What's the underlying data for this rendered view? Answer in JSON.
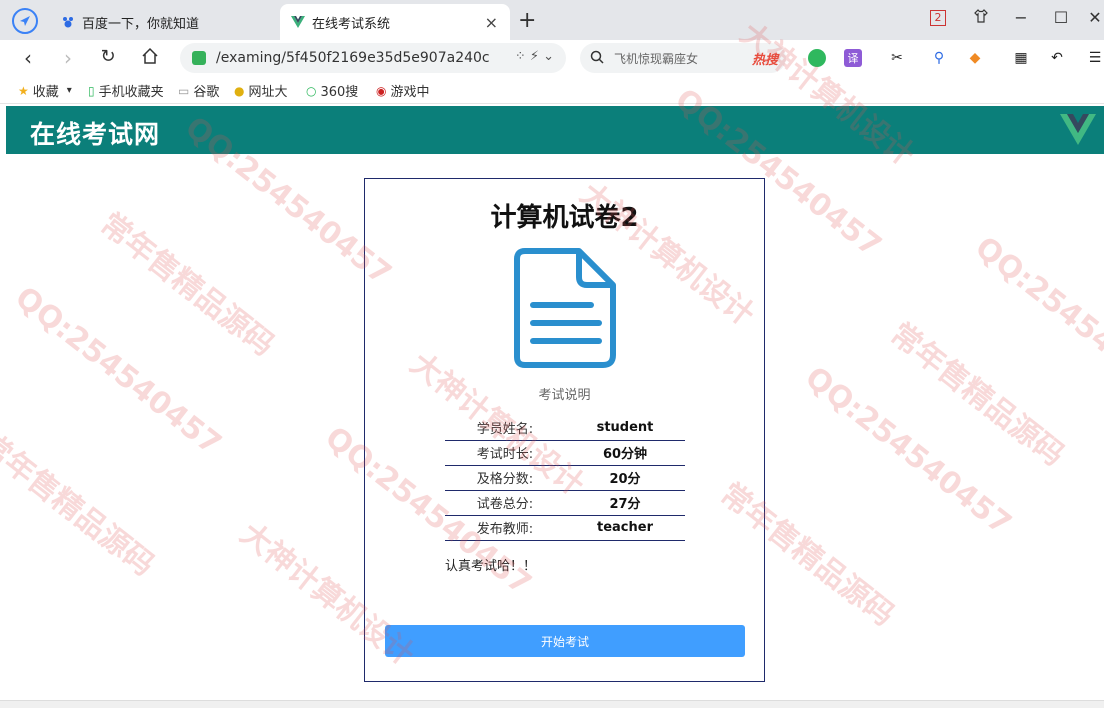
{
  "browser": {
    "tabs": [
      {
        "title": "百度一下，你就知道",
        "icon": "paw-icon"
      },
      {
        "title": "在线考试系统",
        "icon": "vue-icon"
      }
    ],
    "new_tab": "+",
    "tab_count_badge": "2",
    "url": "/examing/5f450f2169e35d5e907a240c",
    "search_placeholder": "飞机惊现霸座女",
    "search_hot": "热搜"
  },
  "bookmarks": [
    {
      "label": "收藏",
      "icon": "star-icon"
    },
    {
      "label": "手机收藏夹",
      "icon": "phone-icon"
    },
    {
      "label": "谷歌",
      "icon": "page-icon"
    },
    {
      "label": "网址大",
      "icon": "web-icon"
    },
    {
      "label": "360搜",
      "icon": "search360-icon"
    },
    {
      "label": "游戏中",
      "icon": "game-icon"
    }
  ],
  "app": {
    "brand": "在线考试网"
  },
  "exam": {
    "title": "计算机试卷2",
    "desc_label": "考试说明",
    "rows": [
      {
        "key": "学员姓名:",
        "value": "student"
      },
      {
        "key": "考试时长:",
        "value": "60分钟"
      },
      {
        "key": "及格分数:",
        "value": "20分"
      },
      {
        "key": "试卷总分:",
        "value": "27分"
      },
      {
        "key": "发布教师:",
        "value": "teacher"
      }
    ],
    "note": "认真考试哈！！",
    "start_button": "开始考试"
  },
  "colors": {
    "header": "#0b7f7a",
    "button": "#409eff",
    "doc_icon": "#2a8fce",
    "card_border": "#1f2a6b"
  },
  "watermarks": [
    "QQ:254540457",
    "常年售精品源码",
    "大神计算机设计"
  ]
}
